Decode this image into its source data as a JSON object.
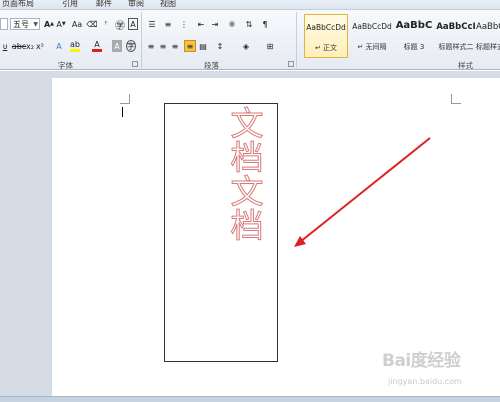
{
  "tabs": [
    "页面布局",
    "引用",
    "邮件",
    "审阅",
    "视图"
  ],
  "font": {
    "size_value": "五号",
    "group_label": "字体"
  },
  "paragraph": {
    "group_label": "段落"
  },
  "styles": {
    "group_label": "样式",
    "items": [
      {
        "sample": "AaBbCcDd",
        "name": "↵ 正文"
      },
      {
        "sample": "AaBbCcDd",
        "name": "↵ 无间隔"
      },
      {
        "sample": "AaBbC",
        "name": "标题 3"
      },
      {
        "sample": "AaBbCcI",
        "name": "标题样式二"
      },
      {
        "sample": "AaBbCcI",
        "name": "标题样式三"
      }
    ]
  },
  "document": {
    "vertical_text": [
      "文",
      "档",
      "文",
      "档"
    ]
  },
  "watermark": {
    "logo": "Bai度经验",
    "url": "jingyan.baidu.com"
  },
  "colors": {
    "outline_text": "#d77a7a",
    "arrow": "#e02020",
    "highlight": "#fff200",
    "font_color": "#e02020"
  }
}
